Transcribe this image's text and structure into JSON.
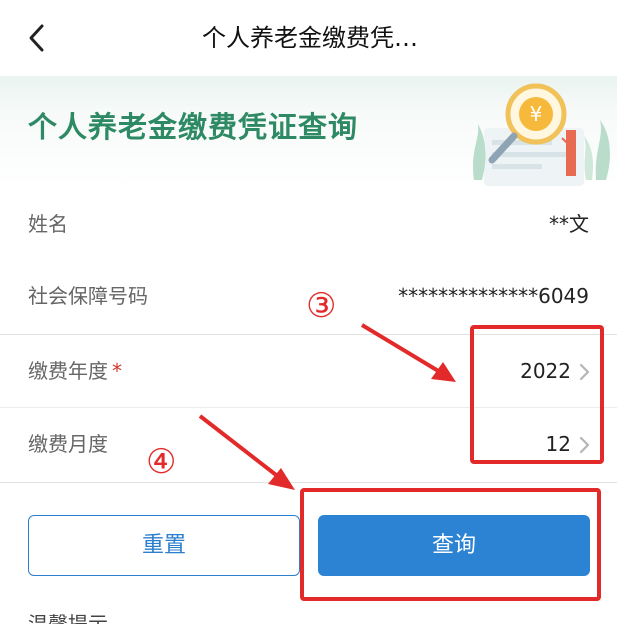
{
  "nav": {
    "title": "个人养老金缴费凭…",
    "back_icon": "chevron-left-icon"
  },
  "banner": {
    "title": "个人养老金缴费凭证查询",
    "illustration": "magnifier-yen-illustration"
  },
  "form": {
    "name": {
      "label": "姓名",
      "value": "**文"
    },
    "ssn": {
      "label": "社会保障号码",
      "value": "**************6049"
    },
    "year": {
      "label": "缴费年度",
      "required_mark": "*",
      "value": "2022"
    },
    "month": {
      "label": "缴费月度",
      "value": "12"
    }
  },
  "actions": {
    "reset_label": "重置",
    "query_label": "查询"
  },
  "footer": {
    "partial_text": "温馨提示"
  },
  "annotations": {
    "step3": "③",
    "step4": "④",
    "color": "#e32a2a"
  },
  "colors": {
    "brand_green": "#2e8a65",
    "primary_blue": "#2c83d3",
    "required_red": "#d2332b"
  }
}
